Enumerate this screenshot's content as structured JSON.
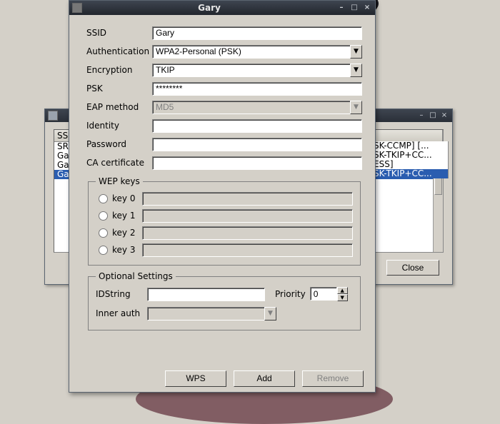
{
  "back_window": {
    "header": {
      "col0": "SSI"
    },
    "rows": [
      {
        "text": "SRX"
      },
      {
        "text": "Gar"
      },
      {
        "text": "Gar"
      },
      {
        "text": "Gar",
        "selected": true
      }
    ],
    "side_rows": [
      "SK-CCMP] [...",
      "SK-TKIP+CC...",
      "ESS]",
      "SK-TKIP+CC..."
    ],
    "close_label": "Close"
  },
  "dialog": {
    "title": "Gary",
    "fields": {
      "ssid_label": "SSID",
      "ssid_value": "Gary",
      "auth_label": "Authentication",
      "auth_value": "WPA2-Personal (PSK)",
      "enc_label": "Encryption",
      "enc_value": "TKIP",
      "psk_label": "PSK",
      "psk_value": "********",
      "eap_label": "EAP method",
      "eap_value": "MD5",
      "identity_label": "Identity",
      "identity_value": "",
      "password_label": "Password",
      "password_value": "",
      "cacert_label": "CA certificate",
      "cacert_value": ""
    },
    "wep": {
      "legend": "WEP keys",
      "keys": [
        {
          "label": "key 0"
        },
        {
          "label": "key 1"
        },
        {
          "label": "key 2"
        },
        {
          "label": "key 3"
        }
      ]
    },
    "optional": {
      "legend": "Optional Settings",
      "idstring_label": "IDString",
      "idstring_value": "",
      "priority_label": "Priority",
      "priority_value": "0",
      "innerauth_label": "Inner auth",
      "innerauth_value": ""
    },
    "buttons": {
      "wps": "WPS",
      "add": "Add",
      "remove": "Remove"
    }
  }
}
